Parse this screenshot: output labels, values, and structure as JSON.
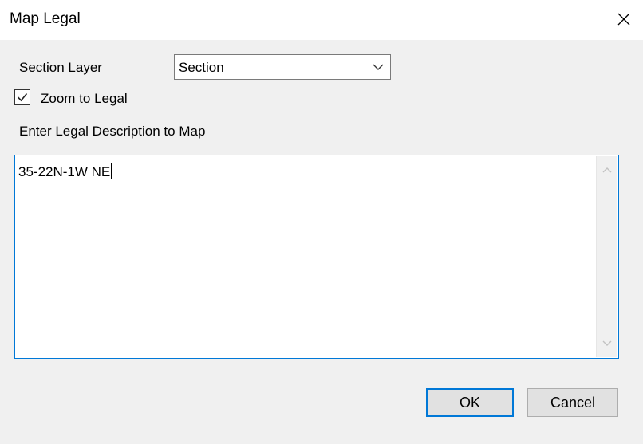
{
  "window": {
    "title": "Map Legal"
  },
  "form": {
    "section_layer_label": "Section Layer",
    "section_layer_value": "Section",
    "zoom_to_legal_label": "Zoom to Legal",
    "zoom_to_legal_checked": true,
    "legal_description_label": "Enter Legal Description to Map",
    "legal_description_value": "35-22N-1W NE"
  },
  "buttons": {
    "ok_label": "OK",
    "cancel_label": "Cancel"
  },
  "icons": {
    "close": "close-icon",
    "dropdown": "chevron-down-icon",
    "check": "checkmark-icon",
    "scroll_up": "chevron-up-icon",
    "scroll_down": "chevron-down-icon"
  },
  "colors": {
    "focus_border": "#0078d7",
    "dialog_background": "#f0f0f0",
    "titlebar_background": "#ffffff"
  }
}
